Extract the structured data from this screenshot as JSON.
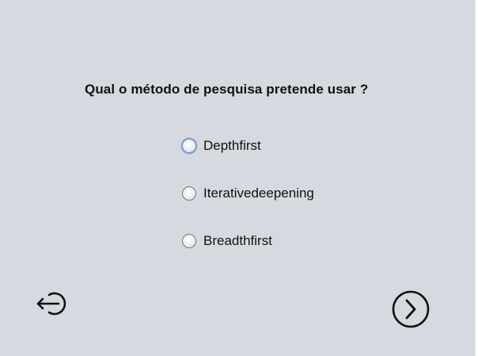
{
  "form": {
    "question": "Qual o método de pesquisa pretende usar ?",
    "options": [
      {
        "label": "Depthfirst",
        "selected": false,
        "focused": true
      },
      {
        "label": "Iterativedeepening",
        "selected": false,
        "focused": false
      },
      {
        "label": "Breadthfirst",
        "selected": false,
        "focused": false
      }
    ]
  },
  "navigation": {
    "back_icon": "exit-arrow-icon",
    "next_icon": "chevron-right-circle-icon"
  },
  "colors": {
    "background": "#d7d9e0",
    "text": "#111111",
    "focus_ring": "#7c9fc8"
  }
}
